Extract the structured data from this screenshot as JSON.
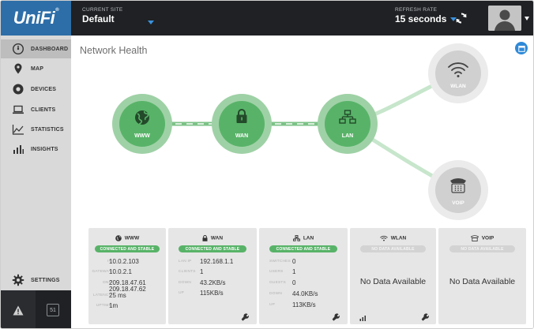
{
  "app": {
    "logo": "UniFi"
  },
  "header": {
    "site_label": "CURRENT SITE",
    "site_value": "Default",
    "refresh_label": "REFRESH RATE",
    "refresh_value": "15 seconds"
  },
  "sidebar": {
    "items": [
      {
        "label": "DASHBOARD",
        "icon": "dashboard-icon"
      },
      {
        "label": "MAP",
        "icon": "map-pin-icon"
      },
      {
        "label": "DEVICES",
        "icon": "devices-icon"
      },
      {
        "label": "CLIENTS",
        "icon": "laptop-icon"
      },
      {
        "label": "STATISTICS",
        "icon": "line-chart-icon"
      },
      {
        "label": "INSIGHTS",
        "icon": "bar-chart-icon"
      }
    ],
    "settings_label": "SETTINGS",
    "events_count": "51"
  },
  "main": {
    "title": "Network Health",
    "nodes": {
      "www": "WWW",
      "wan": "WAN",
      "lan": "LAN",
      "wlan": "WLAN",
      "voip": "VOIP"
    },
    "colors": {
      "green": "#58b368",
      "green_light": "#9fd1a6",
      "gray_node": "#d0d0d0",
      "accent": "#2f8ad8"
    }
  },
  "cards": {
    "www": {
      "title": "WWW",
      "status": "CONNECTED AND STABLE",
      "rows": [
        {
          "k": "IP",
          "v": "10.0.2.103"
        },
        {
          "k": "GATEWAY",
          "v": "10.0.2.1"
        },
        {
          "k": "DNS",
          "v": "209.18.47.61"
        },
        {
          "k": "",
          "v": "209.18.47.62"
        },
        {
          "k": "LATENCY",
          "v": "25 ms"
        },
        {
          "k": "UPTIME",
          "v": "1m"
        }
      ]
    },
    "wan": {
      "title": "WAN",
      "status": "CONNECTED AND STABLE",
      "rows": [
        {
          "k": "LAN IP",
          "v": "192.168.1.1"
        },
        {
          "k": "CLIENTS",
          "v": "1"
        },
        {
          "k": "DOWN",
          "v": "43.2KB/s"
        },
        {
          "k": "UP",
          "v": "115KB/s"
        }
      ]
    },
    "lan": {
      "title": "LAN",
      "status": "CONNECTED AND STABLE",
      "rows": [
        {
          "k": "SWITCHES",
          "v": "0"
        },
        {
          "k": "USERS",
          "v": "1"
        },
        {
          "k": "GUESTS",
          "v": "0"
        },
        {
          "k": "DOWN",
          "v": "44.0KB/s"
        },
        {
          "k": "UP",
          "v": "113KB/s"
        }
      ]
    },
    "wlan": {
      "title": "WLAN",
      "status": "NO DATA AVAILABLE",
      "message": "No Data Available"
    },
    "voip": {
      "title": "VOIP",
      "status": "NO DATA AVAILABLE",
      "message": "No Data Available"
    }
  }
}
